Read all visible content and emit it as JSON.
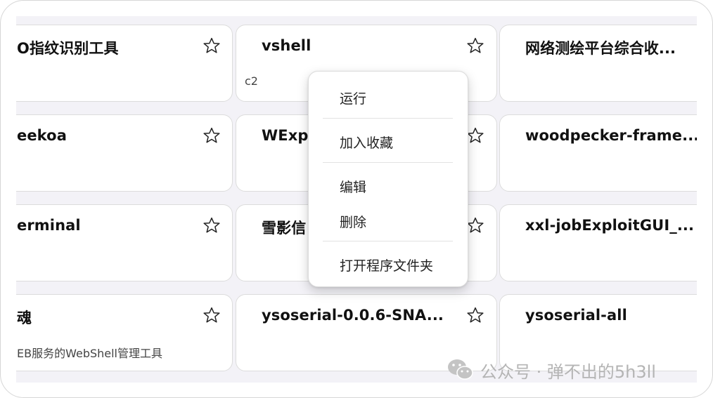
{
  "cards": [
    {
      "title": "O指纹识别工具",
      "desc": ""
    },
    {
      "title": "vshell",
      "desc": "c2"
    },
    {
      "title": "网络测绘平台综合收...",
      "desc": ""
    },
    {
      "title": "eekoa",
      "desc": ""
    },
    {
      "title": "WExpl",
      "desc": ""
    },
    {
      "title": "woodpecker-frame...",
      "desc": ""
    },
    {
      "title": "erminal",
      "desc": ""
    },
    {
      "title": "雪影信",
      "desc": ""
    },
    {
      "title": "xxl-jobExploitGUI_...",
      "desc": ""
    },
    {
      "title": "魂",
      "desc": "EB服务的WebShell管理工具"
    },
    {
      "title": "ysoserial-0.0.6-SNA...",
      "desc": ""
    },
    {
      "title": "ysoserial-all",
      "desc": ""
    }
  ],
  "context_menu": {
    "run": "运行",
    "add_favorite": "加入收藏",
    "edit": "编辑",
    "delete": "删除",
    "open_folder": "打开程序文件夹"
  },
  "watermark": {
    "text": "公众号 · 弹不出的5h3ll"
  },
  "icons": {
    "star": "star-outline-icon",
    "wechat": "wechat-icon"
  },
  "colors": {
    "background": "#f3f2f7",
    "card": "#ffffff",
    "text": "#111111"
  }
}
